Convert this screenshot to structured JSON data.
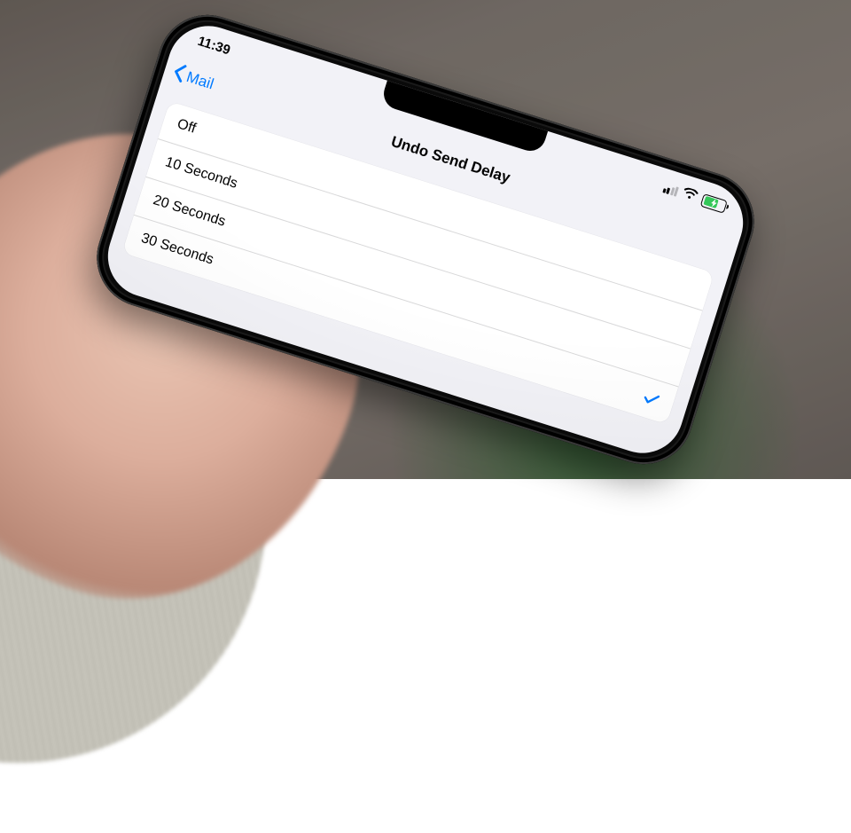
{
  "status": {
    "time": "11:39"
  },
  "nav": {
    "back_label": "Mail",
    "title": "Undo Send Delay"
  },
  "options": {
    "selected_index": 3,
    "items": [
      {
        "label": "Off"
      },
      {
        "label": "10 Seconds"
      },
      {
        "label": "20 Seconds"
      },
      {
        "label": "30 Seconds"
      }
    ]
  },
  "colors": {
    "tint": "#007aff",
    "bg": "#f2f2f7",
    "cell": "#ffffff",
    "charge": "#34c759"
  }
}
